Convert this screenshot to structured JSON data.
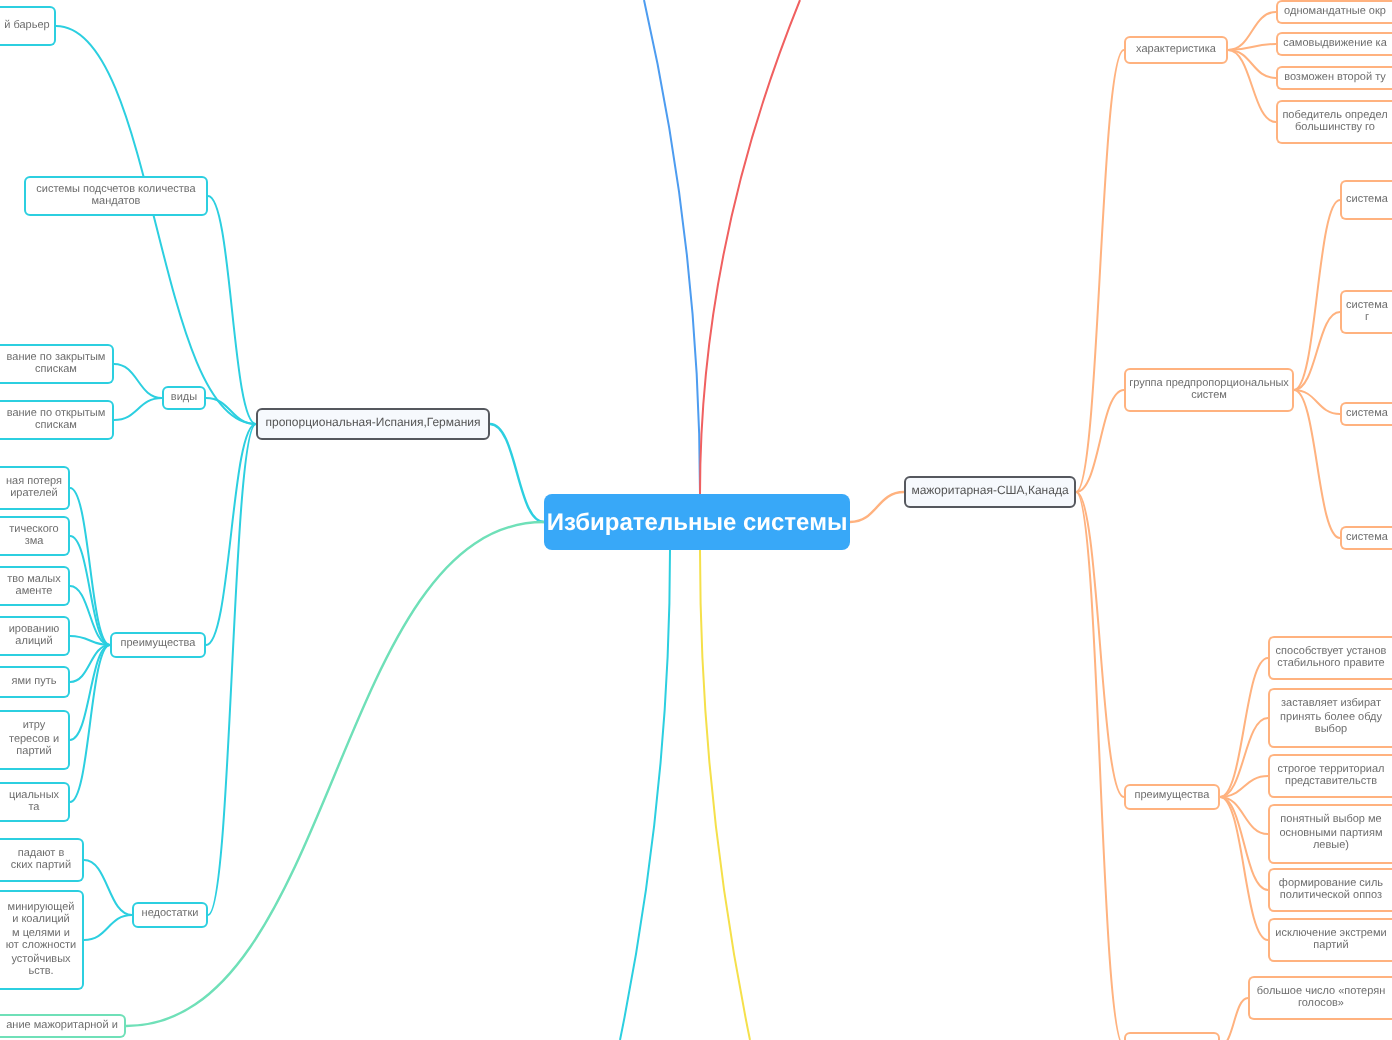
{
  "central_topic": "Избирательные системы",
  "branches": [
    {
      "title": "пропорциональная-Испания,Германия",
      "color": "#2ccfe0",
      "children": [
        {
          "text": "й барьер"
        },
        {
          "text": "системы подсчетов количества\nмандатов"
        },
        {
          "text": "виды",
          "children": [
            {
              "text": "вание по закрытым\nспискам"
            },
            {
              "text": "вание по открытым\nспискам"
            }
          ]
        },
        {
          "text": "преимущества",
          "children": [
            {
              "text": "ная потеря\nирателей"
            },
            {
              "text": "тического\nзма"
            },
            {
              "text": "тво малых\nаменте"
            },
            {
              "text": "ированию\nалиций"
            },
            {
              "text": "ями путь"
            },
            {
              "text": "итру\nтересов и\nпартий"
            },
            {
              "text": "циальных\nта"
            }
          ]
        },
        {
          "text": "недостатки",
          "children": [
            {
              "text": "падают в\nских партий"
            },
            {
              "text": "минирующей\nи коалиций\nм целями и\nют сложности\nустойчивых\nьств."
            }
          ]
        }
      ]
    },
    {
      "title": "мажоритарная-США,Канада",
      "color": "#ffb27f",
      "children": [
        {
          "text": "характеристика",
          "children": [
            {
              "text": "одномандатные окр"
            },
            {
              "text": "самовыдвижение ка"
            },
            {
              "text": "возможен второй ту"
            },
            {
              "text": "победитель определ\nбольшинству го"
            }
          ]
        },
        {
          "text": "группа предпропорциональных\nсистем",
          "children": [
            {
              "text": "система"
            },
            {
              "text": "система\nг"
            },
            {
              "text": "система"
            },
            {
              "text": "система"
            }
          ]
        },
        {
          "text": "преимущества",
          "children": [
            {
              "text": "способствует установ\nстабильного правите"
            },
            {
              "text": "заставляет избират\nпринять более обду\nвыбор"
            },
            {
              "text": "строгое территориал\nпредставительств"
            },
            {
              "text": "понятный выбор ме\nосновными партиям\nлевые)"
            },
            {
              "text": "формирование силь\nполитической оппоз"
            },
            {
              "text": "исключение экстреми\nпартий"
            }
          ]
        },
        {
          "children": [
            {
              "text": "большое число «потерян\nголосов»"
            }
          ]
        }
      ]
    },
    {
      "title": "ание мажоритарной и",
      "color": "#6fe0b8"
    }
  ]
}
